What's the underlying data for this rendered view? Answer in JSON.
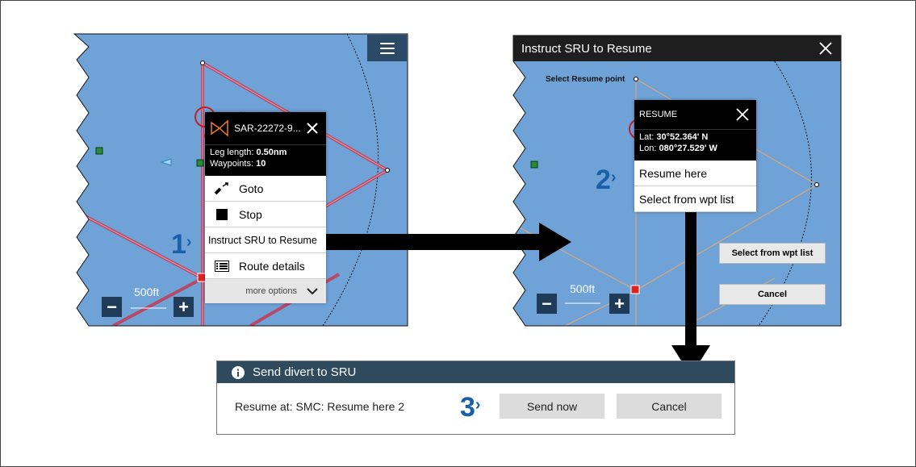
{
  "panel1": {
    "menu_icon": "hamburger-icon",
    "popup": {
      "title": "SAR-22272-9...",
      "icon": "sar-pattern-icon",
      "leg_length_label": "Leg length:",
      "leg_length_value": "0.50nm",
      "waypoints_label": "Waypoints:",
      "waypoints_value": "10",
      "items": [
        {
          "label": "Goto",
          "icon": "goto-icon"
        },
        {
          "label": "Stop",
          "icon": "stop-icon"
        },
        {
          "label": "Instruct SRU to Resume",
          "icon": ""
        },
        {
          "label": "Route details",
          "icon": "list-icon"
        }
      ],
      "more_options": "more options"
    },
    "scale_label": "500ft",
    "zoom_out": "−",
    "zoom_in": "+"
  },
  "panel2": {
    "title": "Instruct SRU to Resume",
    "select_point_label": "Select Resume point",
    "popup": {
      "title": "RESUME",
      "lat_label": "Lat:",
      "lat_value": "30°52.364' N",
      "lon_label": "Lon:",
      "lon_value": "080°27.529' W",
      "items": [
        "Resume here",
        "Select from wpt list"
      ]
    },
    "side_buttons": [
      "Select from wpt list",
      "Cancel"
    ],
    "scale_label": "500ft",
    "zoom_out": "−",
    "zoom_in": "+"
  },
  "dialog": {
    "title": "Send divert to SRU",
    "message": "Resume at: SMC: Resume here 2",
    "send_label": "Send now",
    "cancel_label": "Cancel"
  },
  "steps": [
    "1",
    "2",
    "3"
  ],
  "colors": {
    "water": "#6fa3d8",
    "route": "#c0405a",
    "route_pale": "#d9a77a",
    "header_dark": "#2e4a5c",
    "step_blue": "#1a5fa8"
  }
}
